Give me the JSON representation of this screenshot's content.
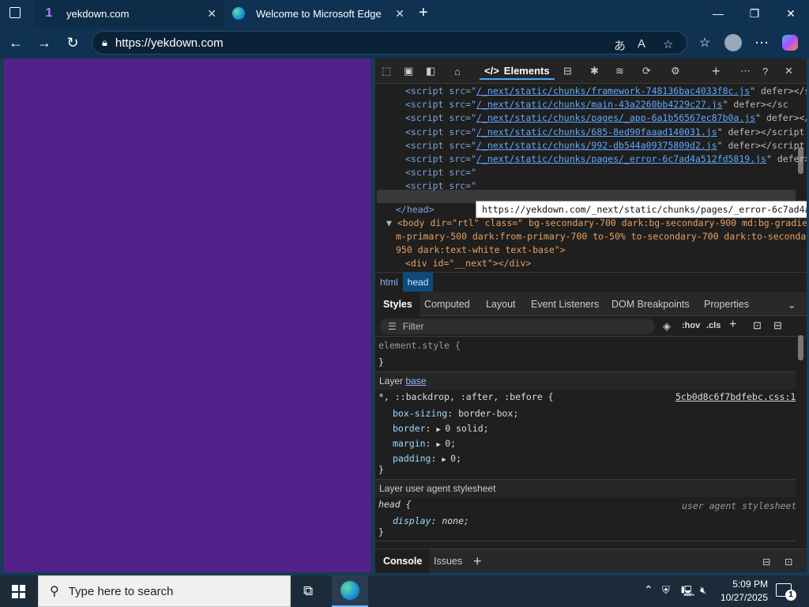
{
  "tabs": [
    {
      "title": "yekdown.com",
      "favicon": "1"
    },
    {
      "title": "Welcome to Microsoft Edge"
    }
  ],
  "address": {
    "url": "https://yekdown.com"
  },
  "devtools": {
    "toolbar": {
      "elements_label": "Elements"
    },
    "dom_lines": [
      {
        "pre": "<script src=\"",
        "link": "/_next/static/chunks/framework-748136bac4033f8c.js",
        "post": "\" defer></sc"
      },
      {
        "pre": "<script src=\"",
        "link": "/_next/static/chunks/main-43a2260bb4229c27.js",
        "post": "\" defer></sc"
      },
      {
        "pre": "<script src=\"",
        "link": "/_next/static/chunks/pages/_app-6a1b56567ec87b0a.js",
        "post": "\" defer></s"
      },
      {
        "pre": "<script src=\"",
        "link": "/_next/static/chunks/685-8ed90faaad140031.js",
        "post": "\" defer></script"
      },
      {
        "pre": "<script src=\"",
        "link": "/_next/static/chunks/992-db544a09375809d2.js",
        "post": "\" defer></script"
      },
      {
        "pre": "<script src=\"",
        "link": "/_next/static/chunks/pages/_error-6c7ad4a512fd5819.js",
        "post": "\" defer></"
      },
      {
        "pre": "<script src=\"",
        "link": "",
        "post": ""
      },
      {
        "pre": "<script src=\"",
        "link": "",
        "post": ""
      }
    ],
    "head_close": "</head>",
    "body_line1": "<body dir=\"rtl\" class=\" bg-secondary-700 dark:bg-secondary-900 md:bg-gradien",
    "body_line2": "m-primary-500 dark:from-primary-700 to-50% to-secondary-700 dark:to-secondar",
    "body_line3": "950 dark:text-white text-base\">",
    "div_line": "<div id=\"__next\"></div>",
    "tooltip": "https://yekdown.com/_next/static/chunks/pages/_error-6c7ad4a512fd5819.js",
    "breadcrumbs": [
      "html",
      "head"
    ],
    "style_tabs": [
      "Styles",
      "Computed",
      "Layout",
      "Event Listeners",
      "DOM Breakpoints",
      "Properties"
    ],
    "filter_placeholder": "Filter",
    "hov": ":hov",
    "cls": ".cls",
    "element_style": "element.style {",
    "close_brace": "}",
    "layer_base_label": "Layer",
    "layer_base_link": "base",
    "rule1_selector": "*, ::backdrop, :after, :before {",
    "rule1_source": "5cb0d8c6f7bdfebc.css:1",
    "rule1_props": [
      {
        "name": "box-sizing",
        "value": "border-box;"
      },
      {
        "name": "border",
        "value": "0 solid;"
      },
      {
        "name": "margin",
        "value": "0;"
      },
      {
        "name": "padding",
        "value": "0;"
      }
    ],
    "layer_ua": "Layer user agent stylesheet",
    "rule2_selector": "head {",
    "rule2_source": "user agent stylesheet",
    "rule2_prop": {
      "name": "display",
      "value": "none;"
    },
    "bottom_tabs": [
      "Console",
      "Issues"
    ]
  },
  "taskbar": {
    "search_placeholder": "Type here to search",
    "time": "5:09 PM",
    "date": "10/27/2025",
    "notif_count": "1"
  }
}
